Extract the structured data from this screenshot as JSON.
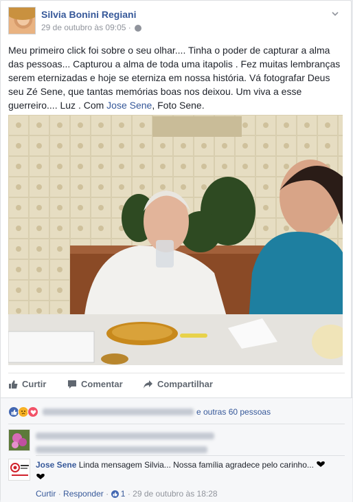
{
  "post": {
    "author": "Silvia Bonini Regiani",
    "timestamp": "29 de outubro às 09:05",
    "privacy_icon": "globe-icon",
    "text_main": "Meu primeiro click foi sobre o seu olhar.... Tinha o poder de capturar a alma das pessoas... Capturou a alma de toda uma itapolis . Fez muitas lembranças serem eternizadas e hoje se eterniza em nossa história. Vá fotografar Deus seu Zé Sene, que tantas memórias boas nos deixou. Um viva a esse guerreiro.... Luz . Com ",
    "tagged_user": "Jose Sene",
    "text_tail": ", Foto Sene."
  },
  "actions": {
    "like_label": "Curtir",
    "comment_label": "Comentar",
    "share_label": "Compartilhar"
  },
  "reactions": {
    "icons": [
      "like-reaction",
      "sad-reaction",
      "love-reaction"
    ],
    "others_text": "e outras 60 pessoas"
  },
  "comments": [
    {
      "author": "",
      "text": ""
    },
    {
      "author": "Jose Sene",
      "text": "Linda mensagem Silvia... Nossa família agradece pelo carinho...",
      "like_label": "Curtir",
      "reply_label": "Responder",
      "like_count": "1",
      "timestamp": "29 de outubro às 18:28"
    }
  ],
  "colors": {
    "link": "#365899",
    "muted": "#90949c",
    "like_blue": "#4267b2",
    "love_red": "#f25268",
    "sad_yellow": "#f7b125"
  }
}
